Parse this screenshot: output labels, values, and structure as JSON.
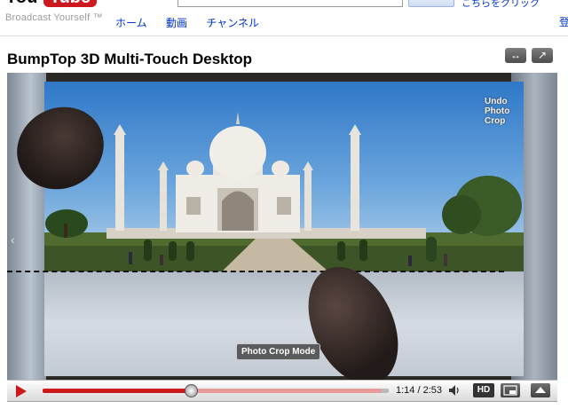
{
  "header": {
    "logo_you": "You",
    "logo_tube": "Tube",
    "tagline": "Broadcast Yourself ™",
    "top_link": "こちらをクリック",
    "right_edge": "登",
    "nav": [
      "ホーム",
      "動画",
      "チャンネル"
    ]
  },
  "video": {
    "title": "BumpTop 3D Multi-Touch Desktop",
    "expand_icon": "↔",
    "popout_icon": "↗",
    "undo_label": "Undo Photo Crop",
    "crop_mode_label": "Photo Crop Mode"
  },
  "player": {
    "time": "1:14 / 2:53",
    "hd_label": "HD",
    "progress": 0.4277,
    "loaded": 0.98
  },
  "colors": {
    "brand_red": "#cc181e",
    "link_blue": "#0033cc"
  }
}
